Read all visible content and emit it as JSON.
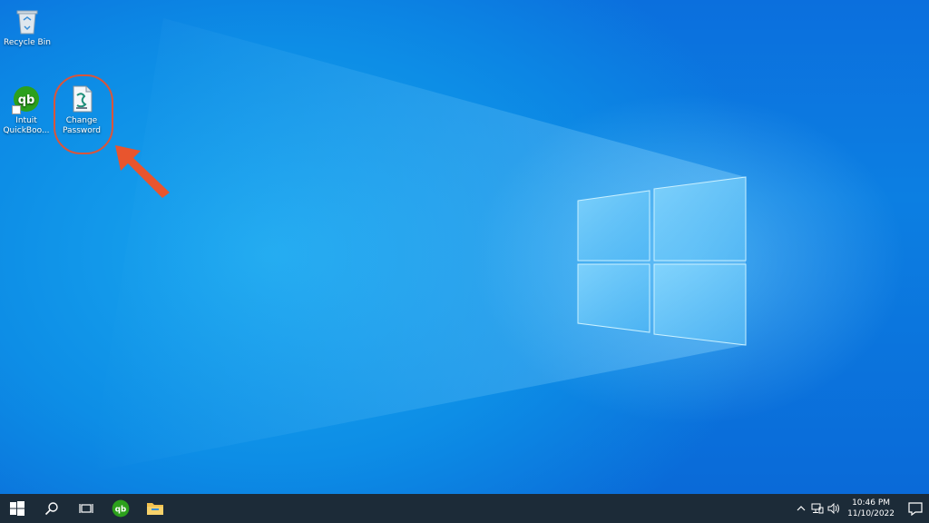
{
  "desktop": {
    "icons": [
      {
        "label": "Recycle Bin",
        "icon": "recycle-bin-icon"
      },
      {
        "label": "Intuit\nQuickBoo...",
        "icon": "quickbooks-icon"
      },
      {
        "label": "Change\nPassword",
        "icon": "script-file-icon"
      }
    ],
    "annotation": {
      "highlight_color": "#d9553b",
      "arrow_color": "#e8552e"
    }
  },
  "taskbar": {
    "buttons": [
      "windows-start-icon",
      "search-icon",
      "task-view-icon",
      "quickbooks-icon",
      "file-explorer-icon"
    ],
    "tray": [
      "chevron-up-icon",
      "network-icon",
      "volume-icon"
    ],
    "time": "10:46 PM",
    "date": "11/10/2022",
    "background": "#1c2b38"
  }
}
